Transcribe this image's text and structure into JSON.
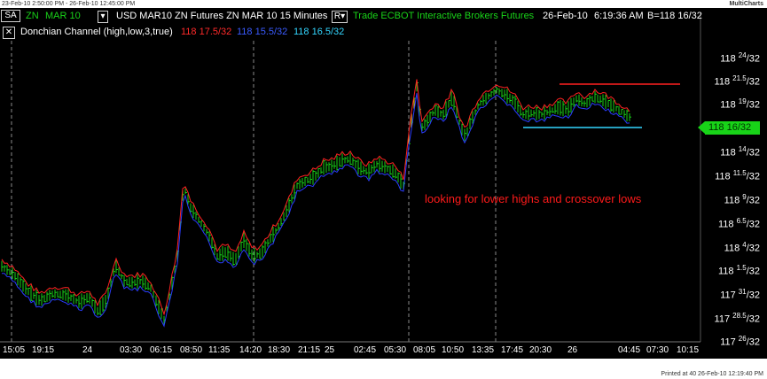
{
  "window": {
    "timestamp_left": "23-Feb-10 2:50:00 PM - 26-Feb-10 12:45:00 PM",
    "app_name": "MultiCharts"
  },
  "header": {
    "symbol_button": "SA",
    "symbol": "ZN",
    "contract": "MAR 10",
    "menu_button": "▾",
    "description": "USD MAR10 ZN Futures ZN   MAR 10  15 Minutes",
    "r_button": "R▾",
    "source": "Trade  ECBOT  Interactive Brokers   Futures",
    "date": "26-Feb-10",
    "time": "6:19:36 AM",
    "bid": "B=118 16/32"
  },
  "indicator": {
    "close_button": "✕",
    "name": "Donchian Channel  (high,low,3,true)",
    "upper": "118 17.5/32",
    "lower": "118 15.5/32",
    "mid": "118 16.5/32"
  },
  "annotation": "looking for lower highs and crossover lows",
  "price_axis": [
    {
      "base": "118 ",
      "frac": "24",
      "den": "/32"
    },
    {
      "base": "118 ",
      "frac": "21.5",
      "den": "/32"
    },
    {
      "base": "118 ",
      "frac": "19",
      "den": "/32"
    },
    {
      "base": "118 ",
      "frac": "16.5",
      "den": "/32"
    },
    {
      "base": "118 ",
      "frac": "14",
      "den": "/32"
    },
    {
      "base": "118 ",
      "frac": "11.5",
      "den": "/32"
    },
    {
      "base": "118 ",
      "frac": "9",
      "den": "/32"
    },
    {
      "base": "118 ",
      "frac": "6.5",
      "den": "/32"
    },
    {
      "base": "118 ",
      "frac": "4",
      "den": "/32"
    },
    {
      "base": "118 ",
      "frac": "1.5",
      "den": "/32"
    },
    {
      "base": "117 ",
      "frac": "31",
      "den": "/32"
    },
    {
      "base": "117 ",
      "frac": "28.5",
      "den": "/32"
    },
    {
      "base": "117 ",
      "frac": "26",
      "den": "/32"
    }
  ],
  "current_price_tag": "118 16/32",
  "time_axis": [
    "15:05",
    "19:15",
    "24",
    "03:30",
    "06:15",
    "08:50",
    "11:35",
    "14:20",
    "18:30",
    "21:15",
    "25",
    "02:45",
    "05:30",
    "08:05",
    "10:50",
    "13:35",
    "17:45",
    "20:30",
    "26",
    "04:45",
    "07:30",
    "10:15"
  ],
  "printed": "Printed at 40 26-Feb-10 12:19:40 PM",
  "colors": {
    "up": "#19d219",
    "upper_channel": "#ff2222",
    "lower_channel": "#2a3cff",
    "mid_channel": "#33d6ff",
    "background": "#000000"
  }
}
